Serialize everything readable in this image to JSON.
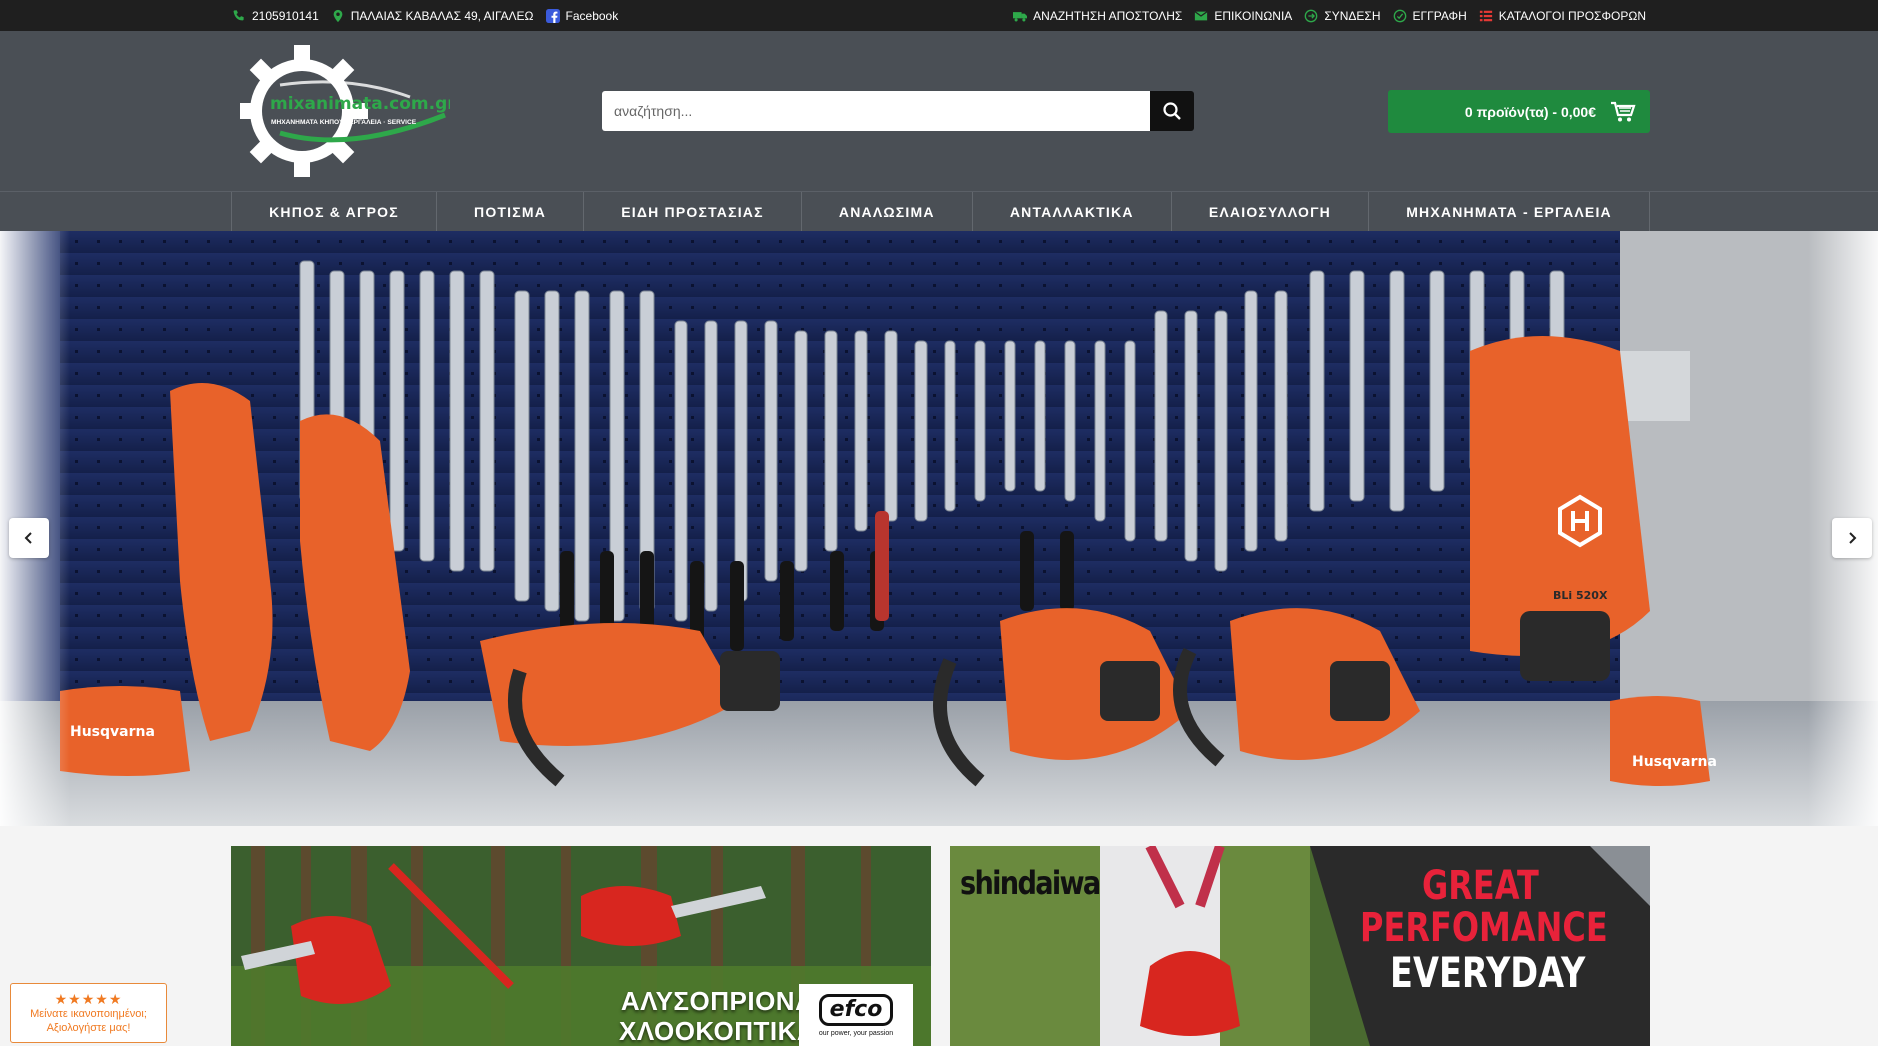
{
  "topbar": {
    "phone": "2105910141",
    "address": "ΠΑΛΑΙΑΣ ΚΑΒΑΛΑΣ 49, ΑΙΓΑΛΕΩ",
    "facebook": "Facebook",
    "links": [
      {
        "label": "ΑΝΑΖΗΤΗΣΗ ΑΠΟΣΤΟΛΗΣ",
        "icon": "truck-icon"
      },
      {
        "label": "ΕΠΙΚΟΙΝΩΝΙΑ",
        "icon": "envelope-icon"
      },
      {
        "label": "ΣΥΝΔΕΣΗ",
        "icon": "login-icon"
      },
      {
        "label": "ΕΓΓΡΑΦΗ",
        "icon": "check-circle-icon"
      },
      {
        "label": "ΚΑΤΑΛΟΓΟΙ ΠΡΟΣΦΟΡΩΝ",
        "icon": "list-icon"
      }
    ]
  },
  "header": {
    "logo_text": "mixanimata.com.gr",
    "logo_tagline": "ΜΗΧΑΝΗΜΑΤΑ ΚΗΠΟΥ · ΕΡΓΑΛΕΙΑ · SERVICE",
    "search_placeholder": "αναζήτηση...",
    "cart_label": "0 προϊόν(τα) - 0,00€"
  },
  "nav": {
    "items": [
      "ΚΗΠΟΣ & ΑΓΡΟΣ",
      "ΠΟΤΙΣΜΑ",
      "ΕΙΔΗ ΠΡΟΣΤΑΣΙΑΣ",
      "ΑΝΑΛΩΣΙΜΑ",
      "ΑΝΤΑΛΛΑΚΤΙΚΑ",
      "ΕΛΑΙΟΣΥΛΛΟΓΗ",
      "ΜΗΧΑΝΗΜΑΤΑ - ΕΡΓΑΛΕΙΑ"
    ]
  },
  "hero": {
    "brand_labels": [
      "Husqvarna",
      "Husqvarna",
      "BLi 520X"
    ]
  },
  "banners": {
    "left": {
      "line1": "ΑΛΥΣΟΠΡΙΟΝΑ",
      "line2": "ΧΛΟΟΚΟΠΤΙΚΑ",
      "brand": "efco",
      "tagline": "our power, your passion"
    },
    "right": {
      "brand": "shindaiwa",
      "line1": "GREAT",
      "line2": "PERFOMANCE",
      "line3": "EVERYDAY"
    }
  },
  "rating_widget": {
    "stars": "★★★★★",
    "line1": "Μείνατε ικανοποιημένοι;",
    "line2": "Αξιολογήστε μας!"
  },
  "colors": {
    "topbar_bg": "#1f1f1f",
    "header_bg": "#4a4f55",
    "accent_green": "#1f8a3e",
    "icon_green": "#2ea84a",
    "husqvarna_orange": "#e8622a",
    "rating_orange": "#f07a22"
  }
}
